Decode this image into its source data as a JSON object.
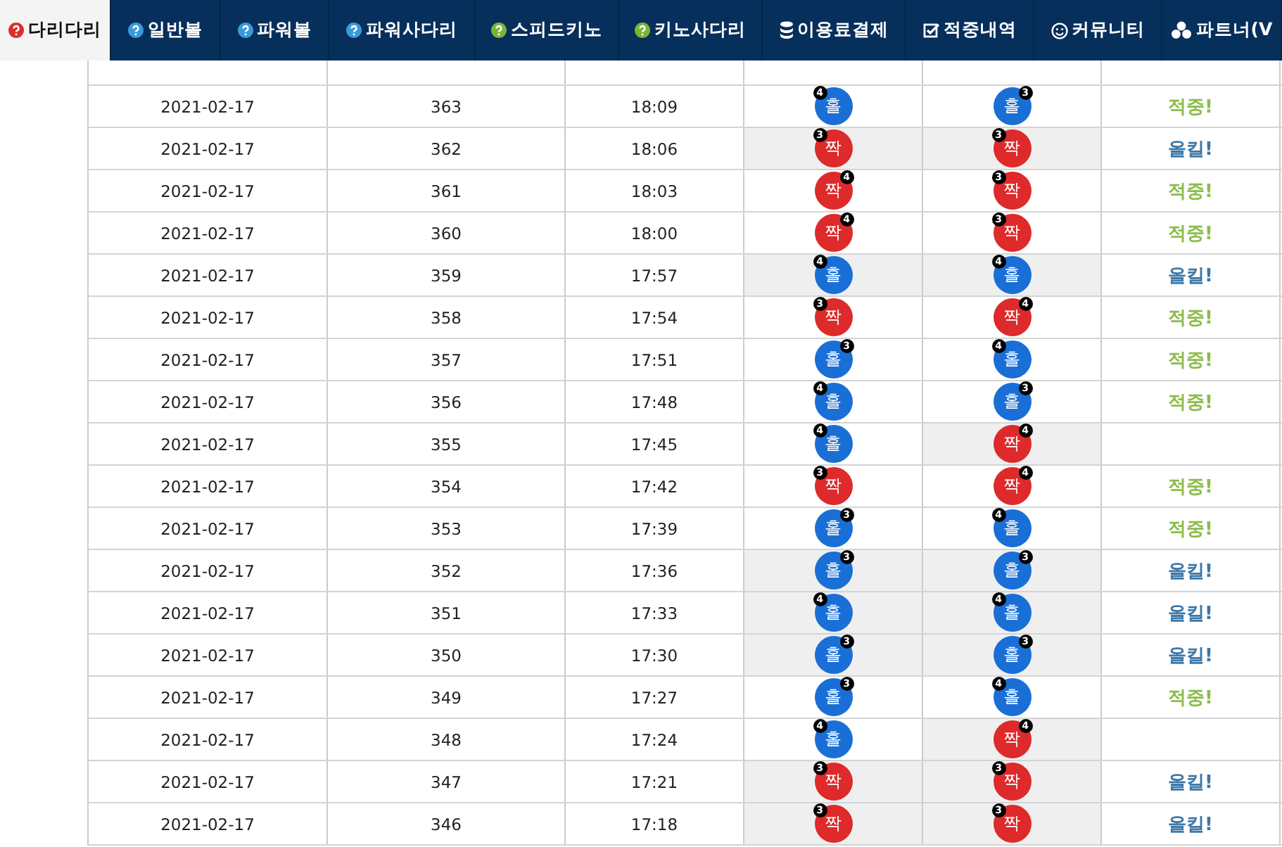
{
  "nav": {
    "tabs": [
      {
        "label": "다리다리",
        "selected": true
      },
      {
        "label": "일반볼",
        "selected": false
      },
      {
        "label": "파워볼",
        "selected": false
      },
      {
        "label": "파워사다리",
        "selected": false
      },
      {
        "label": "스피드키노",
        "selected": false
      },
      {
        "label": "키노사다리",
        "selected": false
      },
      {
        "label": "이용료결제",
        "selected": false
      },
      {
        "label": "적중내역",
        "selected": false
      },
      {
        "label": "커뮤니티",
        "selected": false
      },
      {
        "label": "파트너(V",
        "selected": false
      }
    ]
  },
  "table": {
    "rows": [
      {
        "date": "2021-02-17",
        "round": "363",
        "time": "18:09",
        "picks": [
          {
            "label": "홀",
            "kind": "odd",
            "badge": {
              "label": "4",
              "kind": "left"
            },
            "shaded": false
          },
          {
            "label": "홀",
            "kind": "odd",
            "badge": {
              "label": "3",
              "kind": "right"
            },
            "shaded": false
          }
        ],
        "result": {
          "text": "적중!",
          "kind": "hit"
        }
      },
      {
        "date": "2021-02-17",
        "round": "362",
        "time": "18:06",
        "picks": [
          {
            "label": "짝",
            "kind": "even",
            "badge": {
              "label": "3",
              "kind": "left"
            },
            "shaded": true
          },
          {
            "label": "짝",
            "kind": "even",
            "badge": {
              "label": "3",
              "kind": "left"
            },
            "shaded": true
          }
        ],
        "result": {
          "text": "올킬!",
          "kind": "allkill"
        }
      },
      {
        "date": "2021-02-17",
        "round": "361",
        "time": "18:03",
        "picks": [
          {
            "label": "짝",
            "kind": "even",
            "badge": {
              "label": "4",
              "kind": "right"
            },
            "shaded": false
          },
          {
            "label": "짝",
            "kind": "even",
            "badge": {
              "label": "3",
              "kind": "left"
            },
            "shaded": false
          }
        ],
        "result": {
          "text": "적중!",
          "kind": "hit"
        }
      },
      {
        "date": "2021-02-17",
        "round": "360",
        "time": "18:00",
        "picks": [
          {
            "label": "짝",
            "kind": "even",
            "badge": {
              "label": "4",
              "kind": "right"
            },
            "shaded": false
          },
          {
            "label": "짝",
            "kind": "even",
            "badge": {
              "label": "3",
              "kind": "left"
            },
            "shaded": false
          }
        ],
        "result": {
          "text": "적중!",
          "kind": "hit"
        }
      },
      {
        "date": "2021-02-17",
        "round": "359",
        "time": "17:57",
        "picks": [
          {
            "label": "홀",
            "kind": "odd",
            "badge": {
              "label": "4",
              "kind": "left"
            },
            "shaded": true
          },
          {
            "label": "홀",
            "kind": "odd",
            "badge": {
              "label": "4",
              "kind": "left"
            },
            "shaded": true
          }
        ],
        "result": {
          "text": "올킬!",
          "kind": "allkill"
        }
      },
      {
        "date": "2021-02-17",
        "round": "358",
        "time": "17:54",
        "picks": [
          {
            "label": "짝",
            "kind": "even",
            "badge": {
              "label": "3",
              "kind": "left"
            },
            "shaded": false
          },
          {
            "label": "짝",
            "kind": "even",
            "badge": {
              "label": "4",
              "kind": "right"
            },
            "shaded": false
          }
        ],
        "result": {
          "text": "적중!",
          "kind": "hit"
        }
      },
      {
        "date": "2021-02-17",
        "round": "357",
        "time": "17:51",
        "picks": [
          {
            "label": "홀",
            "kind": "odd",
            "badge": {
              "label": "3",
              "kind": "right"
            },
            "shaded": false
          },
          {
            "label": "홀",
            "kind": "odd",
            "badge": {
              "label": "4",
              "kind": "left"
            },
            "shaded": false
          }
        ],
        "result": {
          "text": "적중!",
          "kind": "hit"
        }
      },
      {
        "date": "2021-02-17",
        "round": "356",
        "time": "17:48",
        "picks": [
          {
            "label": "홀",
            "kind": "odd",
            "badge": {
              "label": "4",
              "kind": "left"
            },
            "shaded": false
          },
          {
            "label": "홀",
            "kind": "odd",
            "badge": {
              "label": "3",
              "kind": "right"
            },
            "shaded": false
          }
        ],
        "result": {
          "text": "적중!",
          "kind": "hit"
        }
      },
      {
        "date": "2021-02-17",
        "round": "355",
        "time": "17:45",
        "picks": [
          {
            "label": "홀",
            "kind": "odd",
            "badge": {
              "label": "4",
              "kind": "left"
            },
            "shaded": false
          },
          {
            "label": "짝",
            "kind": "even",
            "badge": {
              "label": "4",
              "kind": "right"
            },
            "shaded": true
          }
        ]
      },
      {
        "date": "2021-02-17",
        "round": "354",
        "time": "17:42",
        "picks": [
          {
            "label": "짝",
            "kind": "even",
            "badge": {
              "label": "3",
              "kind": "left"
            },
            "shaded": false
          },
          {
            "label": "짝",
            "kind": "even",
            "badge": {
              "label": "4",
              "kind": "right"
            },
            "shaded": false
          }
        ],
        "result": {
          "text": "적중!",
          "kind": "hit"
        }
      },
      {
        "date": "2021-02-17",
        "round": "353",
        "time": "17:39",
        "picks": [
          {
            "label": "홀",
            "kind": "odd",
            "badge": {
              "label": "3",
              "kind": "right"
            },
            "shaded": false
          },
          {
            "label": "홀",
            "kind": "odd",
            "badge": {
              "label": "4",
              "kind": "left"
            },
            "shaded": false
          }
        ],
        "result": {
          "text": "적중!",
          "kind": "hit"
        }
      },
      {
        "date": "2021-02-17",
        "round": "352",
        "time": "17:36",
        "picks": [
          {
            "label": "홀",
            "kind": "odd",
            "badge": {
              "label": "3",
              "kind": "right"
            },
            "shaded": true
          },
          {
            "label": "홀",
            "kind": "odd",
            "badge": {
              "label": "3",
              "kind": "right"
            },
            "shaded": true
          }
        ],
        "result": {
          "text": "올킬!",
          "kind": "allkill"
        }
      },
      {
        "date": "2021-02-17",
        "round": "351",
        "time": "17:33",
        "picks": [
          {
            "label": "홀",
            "kind": "odd",
            "badge": {
              "label": "4",
              "kind": "left"
            },
            "shaded": true
          },
          {
            "label": "홀",
            "kind": "odd",
            "badge": {
              "label": "4",
              "kind": "left"
            },
            "shaded": true
          }
        ],
        "result": {
          "text": "올킬!",
          "kind": "allkill"
        }
      },
      {
        "date": "2021-02-17",
        "round": "350",
        "time": "17:30",
        "picks": [
          {
            "label": "홀",
            "kind": "odd",
            "badge": {
              "label": "3",
              "kind": "right"
            },
            "shaded": true
          },
          {
            "label": "홀",
            "kind": "odd",
            "badge": {
              "label": "3",
              "kind": "right"
            },
            "shaded": true
          }
        ],
        "result": {
          "text": "올킬!",
          "kind": "allkill"
        }
      },
      {
        "date": "2021-02-17",
        "round": "349",
        "time": "17:27",
        "picks": [
          {
            "label": "홀",
            "kind": "odd",
            "badge": {
              "label": "3",
              "kind": "right"
            },
            "shaded": false
          },
          {
            "label": "홀",
            "kind": "odd",
            "badge": {
              "label": "4",
              "kind": "left"
            },
            "shaded": false
          }
        ],
        "result": {
          "text": "적중!",
          "kind": "hit"
        }
      },
      {
        "date": "2021-02-17",
        "round": "348",
        "time": "17:24",
        "picks": [
          {
            "label": "홀",
            "kind": "odd",
            "badge": {
              "label": "4",
              "kind": "left"
            },
            "shaded": false
          },
          {
            "label": "짝",
            "kind": "even",
            "badge": {
              "label": "4",
              "kind": "right"
            },
            "shaded": true
          }
        ]
      },
      {
        "date": "2021-02-17",
        "round": "347",
        "time": "17:21",
        "picks": [
          {
            "label": "짝",
            "kind": "even",
            "badge": {
              "label": "3",
              "kind": "left"
            },
            "shaded": true
          },
          {
            "label": "짝",
            "kind": "even",
            "badge": {
              "label": "3",
              "kind": "left"
            },
            "shaded": true
          }
        ],
        "result": {
          "text": "올킬!",
          "kind": "allkill"
        }
      },
      {
        "date": "2021-02-17",
        "round": "346",
        "time": "17:18",
        "picks": [
          {
            "label": "짝",
            "kind": "even",
            "badge": {
              "label": "3",
              "kind": "left"
            },
            "shaded": true
          },
          {
            "label": "짝",
            "kind": "even",
            "badge": {
              "label": "3",
              "kind": "left"
            },
            "shaded": true
          }
        ],
        "result": {
          "text": "올킬!",
          "kind": "allkill"
        }
      }
    ]
  }
}
